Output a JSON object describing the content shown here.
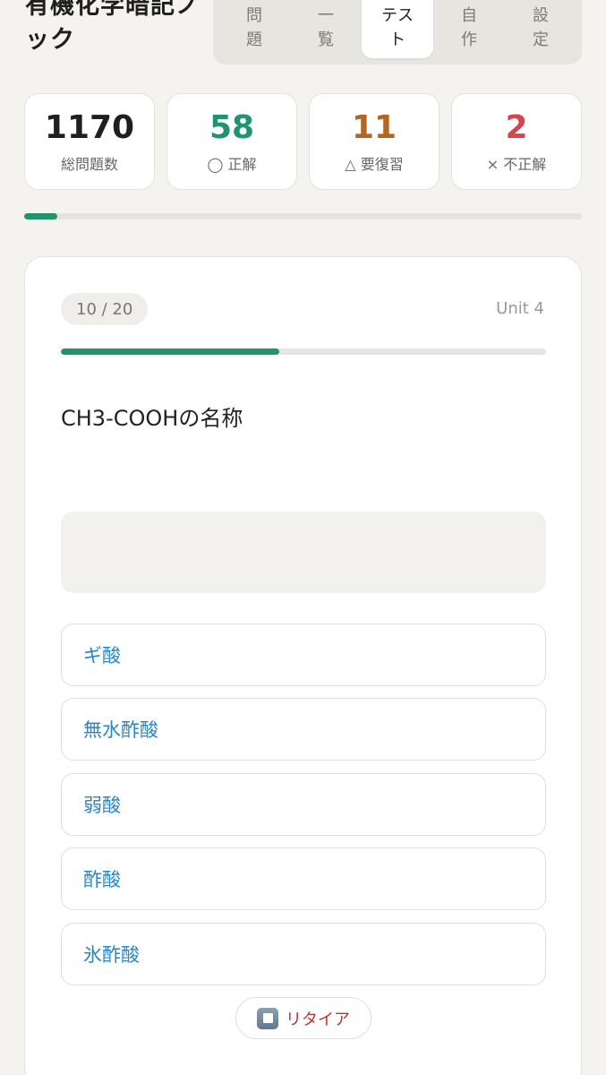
{
  "app": {
    "title": "有機化学暗記ノック"
  },
  "tabs": [
    {
      "label": "問題",
      "active": false
    },
    {
      "label": "一覧",
      "active": false
    },
    {
      "label": "テスト",
      "active": true
    },
    {
      "label": "自作",
      "active": false
    },
    {
      "label": "設定",
      "active": false
    }
  ],
  "stats": {
    "total": {
      "value": "1170",
      "label": "総問題数",
      "color": "#1f1f1f"
    },
    "correct": {
      "value": "58",
      "label": "◯ 正解",
      "color": "#21936f"
    },
    "review": {
      "value": "11",
      "label": "△ 要復習",
      "color": "#b5651d"
    },
    "wrong": {
      "value": "2",
      "label": "× 不正解",
      "color": "#d9434b"
    }
  },
  "overall_progress": {
    "fraction": 0.06
  },
  "test": {
    "counter": "10 / 20",
    "unit": "Unit 4",
    "progress_fraction": 0.45,
    "question": "CH3-COOHの名称",
    "answer": "",
    "choices": [
      "ギ酸",
      "無水酢酸",
      "弱酸",
      "酢酸",
      "氷酢酸"
    ],
    "retire_label": "リタイア",
    "retire_icon": "stop-button-icon"
  }
}
